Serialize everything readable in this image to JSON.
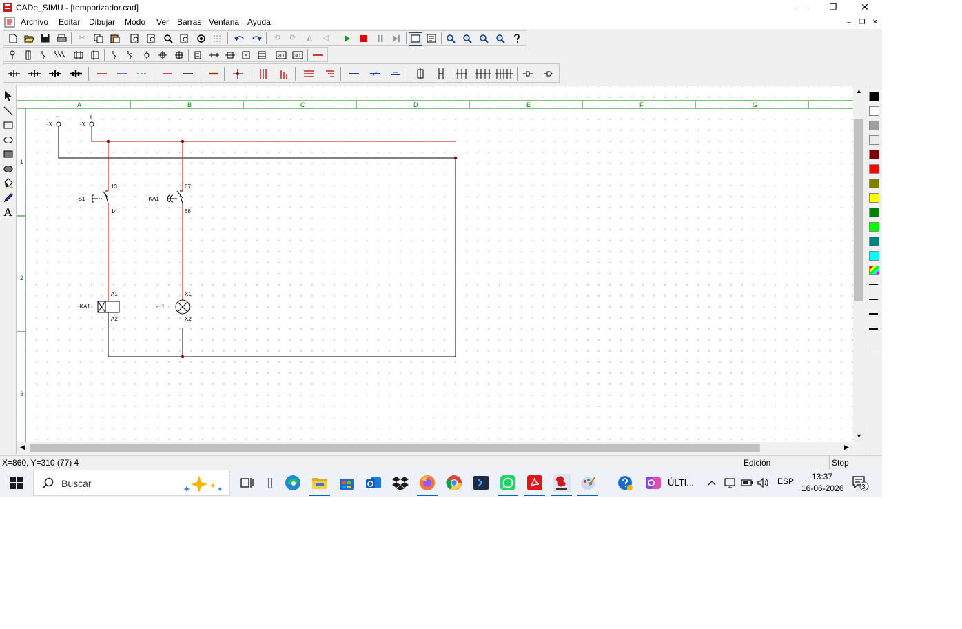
{
  "window": {
    "title": "CADe_SIMU - [temporizador.cad]",
    "min_glyph": "—",
    "max_glyph": "❐",
    "close_glyph": "✕",
    "mdi_min": "–",
    "mdi_restore": "❐",
    "mdi_close": "✕"
  },
  "menu": [
    "Archivo",
    "Editar",
    "Dibujar",
    "Modo",
    "Ver",
    "Barras",
    "Ventana",
    "Ayuda"
  ],
  "drawing": {
    "columns": [
      "A",
      "B",
      "C",
      "D",
      "E",
      "F",
      "G"
    ],
    "rows": [
      "1",
      "2",
      "3"
    ],
    "supply_minus": "-X",
    "supply_plus": "-X",
    "minus_sign": "−",
    "plus_sign": "+",
    "s1_label": "-S1",
    "s1_top": "13",
    "s1_bottom": "14",
    "ka1_contact_label": "-KA1",
    "ka1_contact_top": "67",
    "ka1_contact_bottom": "68",
    "coil_label": "-KA1",
    "coil_top": "A1",
    "coil_bottom": "A2",
    "lamp_label": "-H1",
    "lamp_top": "X1",
    "lamp_bottom": "X2"
  },
  "palette": {
    "colors": [
      "#000000",
      "#ffffff",
      "#a0a0a0",
      "#ececec",
      "#800000",
      "#ff0000",
      "#808000",
      "#ffff00",
      "#008000",
      "#00ff00",
      "#008080",
      "#00ffff"
    ]
  },
  "status": {
    "coords": "X=860, Y=310 (77) 4",
    "mode": "Edición",
    "state": "Stop"
  },
  "taskbar": {
    "search_placeholder": "Buscar",
    "app_label": "ÚLTI...",
    "language": "ESP",
    "time": "13:37",
    "date": "16-06-2026",
    "notifications": "3"
  }
}
